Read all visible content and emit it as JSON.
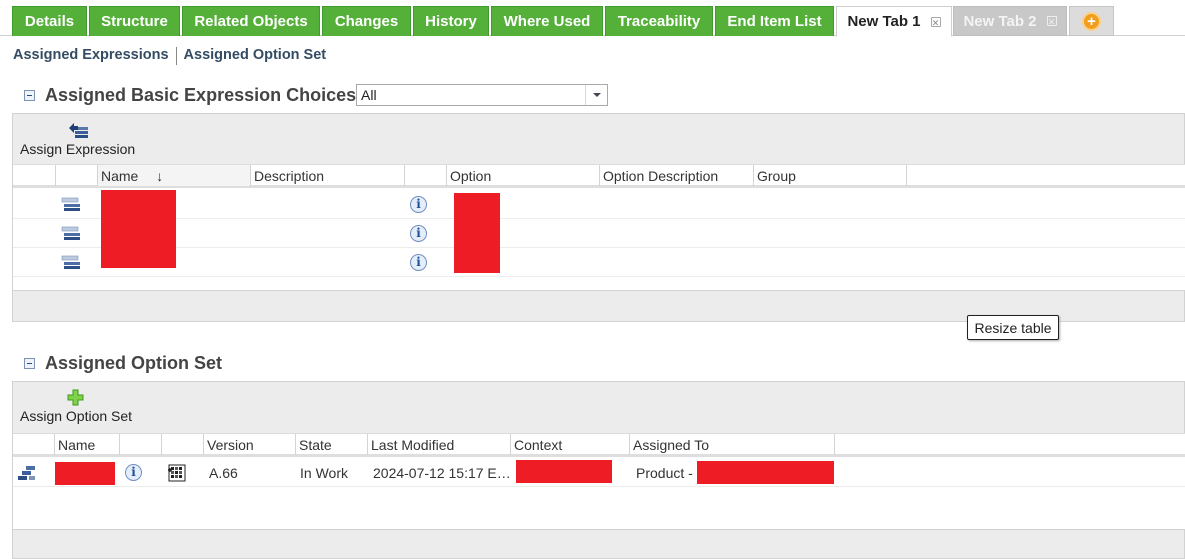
{
  "tabs": [
    {
      "label": "Details",
      "state": "green"
    },
    {
      "label": "Structure",
      "state": "green"
    },
    {
      "label": "Related Objects",
      "state": "green"
    },
    {
      "label": "Changes",
      "state": "green"
    },
    {
      "label": "History",
      "state": "green"
    },
    {
      "label": "Where Used",
      "state": "green"
    },
    {
      "label": "Traceability",
      "state": "green"
    },
    {
      "label": "End Item List",
      "state": "green"
    },
    {
      "label": "New Tab 1",
      "state": "active"
    },
    {
      "label": "New Tab 2",
      "state": "inactive"
    }
  ],
  "sublinks": {
    "assigned_expressions": "Assigned Expressions",
    "assigned_option_set": "Assigned Option Set"
  },
  "expressions_section": {
    "title": "Assigned Basic Expression Choices",
    "filter_value": "All",
    "toolbar_action": "Assign Expression",
    "columns": [
      "Name",
      "Description",
      "Option",
      "Option Description",
      "Group"
    ],
    "sort_indicator": "↓",
    "rows": [
      {
        "name": "",
        "description": "",
        "option": "",
        "option_description": "",
        "group": ""
      },
      {
        "name": "",
        "description": "",
        "option": "",
        "option_description": "",
        "group": ""
      },
      {
        "name": "",
        "description": "",
        "option": "",
        "option_description": "",
        "group": ""
      }
    ]
  },
  "tooltip": "Resize table",
  "option_set_section": {
    "title": "Assigned Option Set",
    "toolbar_action": "Assign Option Set",
    "columns": [
      "Name",
      "Version",
      "State",
      "Last Modified",
      "Context",
      "Assigned To"
    ],
    "rows": [
      {
        "name": "",
        "version": "A.66",
        "state": "In Work",
        "last_modified": "2024-07-12 15:17 E…",
        "context": "",
        "assigned_to": "Product - "
      }
    ]
  },
  "colors": {
    "tab_green": "#55b03a",
    "redaction": "#ee1c25",
    "header_text": "#444444",
    "link_text": "#344c63"
  }
}
